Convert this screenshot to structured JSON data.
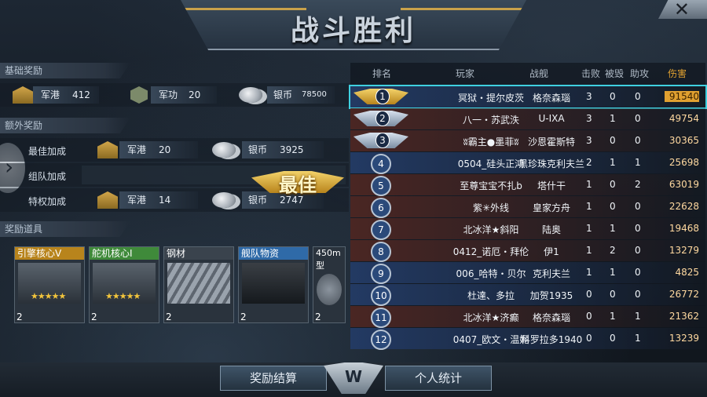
{
  "title": "战斗胜利",
  "close_label": "✕",
  "sections": {
    "basic": "基础奖励",
    "extra": "额外奖励",
    "items": "奖励道具"
  },
  "basic_rewards": {
    "port_label": "军港",
    "port_value": "412",
    "merit_label": "军功",
    "merit_value": "20",
    "silver_label": "银币",
    "silver_value": "78500"
  },
  "best_badge": "最佳",
  "extra_rewards": [
    {
      "name": "最佳加成",
      "port_label": "军港",
      "port_value": "20",
      "silver_label": "银币",
      "silver_value": "3925"
    },
    {
      "name": "组队加成"
    },
    {
      "name": "特权加成",
      "port_label": "军港",
      "port_value": "14",
      "silver_label": "银币",
      "silver_value": "2747"
    }
  ],
  "items": [
    {
      "name": "引擎核心Ⅴ",
      "count": "2",
      "stars": "★★★★★",
      "color": "#b8841c"
    },
    {
      "name": "舵机核心Ⅰ",
      "count": "2",
      "stars": "★★★★★",
      "color": "#3f8a3a"
    },
    {
      "name": "钢材",
      "count": "2",
      "stars": "",
      "color": "#3a434d"
    },
    {
      "name": "舰队物资",
      "count": "2",
      "stars": "",
      "color": "#2f6aa8"
    },
    {
      "name": "450m型",
      "count": "2",
      "stars": "",
      "color": "#3a434d"
    }
  ],
  "table": {
    "headers": {
      "rank": "排名",
      "player": "玩家",
      "ship": "战舰",
      "kills": "击败",
      "destroyed": "被毁",
      "assists": "助攻",
      "damage": "伤害"
    },
    "rows": [
      {
        "rank": "1",
        "player": "冥狱・提尔皮茨",
        "ship": "格奈森瑙",
        "kills": "3",
        "destroyed": "0",
        "assists": "0",
        "damage": "91540",
        "side": "ally"
      },
      {
        "rank": "2",
        "player": "八一・苏武泆",
        "ship": "U-IXA",
        "kills": "3",
        "destroyed": "1",
        "assists": "0",
        "damage": "49754",
        "side": "enemy"
      },
      {
        "rank": "3",
        "player": "ʬ霸主●墨菲ʬ",
        "ship": "沙恩霍斯特",
        "kills": "3",
        "destroyed": "0",
        "assists": "0",
        "damage": "30365",
        "side": "enemy"
      },
      {
        "rank": "4",
        "player": "0504_硅头正鸿",
        "ship": "黑珍珠克利夫兰",
        "kills": "2",
        "destroyed": "1",
        "assists": "1",
        "damage": "25698",
        "side": "ally"
      },
      {
        "rank": "5",
        "player": "至尊宝宝不扎b",
        "ship": "塔什干",
        "kills": "1",
        "destroyed": "0",
        "assists": "2",
        "damage": "63019",
        "side": "enemy"
      },
      {
        "rank": "6",
        "player": "紫✳外线",
        "ship": "皇家方舟",
        "kills": "1",
        "destroyed": "0",
        "assists": "0",
        "damage": "22628",
        "side": "enemy"
      },
      {
        "rank": "7",
        "player": "北冰洋★斜阳",
        "ship": "陆奥",
        "kills": "1",
        "destroyed": "1",
        "assists": "0",
        "damage": "19468",
        "side": "enemy"
      },
      {
        "rank": "8",
        "player": "0412_诺厄・拜伦",
        "ship": "伊1",
        "kills": "1",
        "destroyed": "2",
        "assists": "0",
        "damage": "13279",
        "side": "enemy"
      },
      {
        "rank": "9",
        "player": "006_哈特・贝尔",
        "ship": "克利夫兰",
        "kills": "1",
        "destroyed": "1",
        "assists": "0",
        "damage": "4825",
        "side": "ally"
      },
      {
        "rank": "10",
        "player": "杜達、多拉",
        "ship": "加贺1935",
        "kills": "0",
        "destroyed": "0",
        "assists": "0",
        "damage": "26772",
        "side": "ally"
      },
      {
        "rank": "11",
        "player": "北冰洋★济癫",
        "ship": "格奈森瑙",
        "kills": "0",
        "destroyed": "1",
        "assists": "1",
        "damage": "21362",
        "side": "enemy"
      },
      {
        "rank": "12",
        "player": "0407_欧文・温妮",
        "ship": "科罗拉多1940",
        "kills": "0",
        "destroyed": "0",
        "assists": "1",
        "damage": "13239",
        "side": "ally"
      }
    ]
  },
  "bottom": {
    "left_button": "奖励结算",
    "right_button": "个人统计",
    "emblem": "W"
  },
  "colors": {
    "ally_row": "#233a63",
    "enemy_row": "#4a2623",
    "highlight": "#e0a030",
    "damage_text": "#ffd9a0"
  }
}
